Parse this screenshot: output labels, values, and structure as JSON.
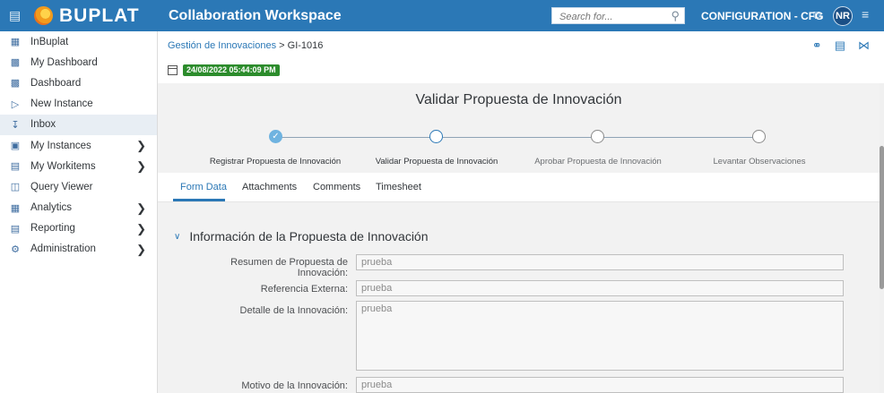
{
  "topbar": {
    "brand": "BUPLAT",
    "title": "Collaboration Workspace",
    "search_placeholder": "Search for...",
    "config_label": "CONFIGURATION - CFG",
    "avatar_initials": "NR",
    "accent_color": "#2b78b6"
  },
  "sidebar": {
    "items": [
      {
        "label": "InBuplat",
        "icon": "building-icon"
      },
      {
        "label": "My Dashboard",
        "icon": "dashboard-icon"
      },
      {
        "label": "Dashboard",
        "icon": "dashboard-icon"
      },
      {
        "label": "New Instance",
        "icon": "play-plus-icon"
      },
      {
        "label": "Inbox",
        "icon": "inbox-download-icon",
        "active": true
      },
      {
        "label": "My Instances",
        "icon": "instances-icon",
        "has_chevron": true
      },
      {
        "label": "My Workitems",
        "icon": "workitems-icon",
        "has_chevron": true
      },
      {
        "label": "Query Viewer",
        "icon": "query-icon"
      },
      {
        "label": "Analytics",
        "icon": "analytics-icon",
        "has_chevron": true
      },
      {
        "label": "Reporting",
        "icon": "reporting-icon",
        "has_chevron": true
      },
      {
        "label": "Administration",
        "icon": "admin-gear-icon",
        "has_chevron": true
      }
    ]
  },
  "header": {
    "breadcrumb_link": "Gestión de Innovaciones",
    "breadcrumb_separator": ">",
    "breadcrumb_current": "GI-1016",
    "timestamp": "24/08/2022 05:44:09 PM",
    "timestamp_color": "#2c8c2c"
  },
  "page": {
    "title": "Validar Propuesta de Innovación"
  },
  "steps": [
    {
      "label": "Registrar Propuesta de Innovación",
      "state": "done"
    },
    {
      "label": "Validar Propuesta de Innovación",
      "state": "current"
    },
    {
      "label": "Aprobar Propuesta de Innovación",
      "state": "pending"
    },
    {
      "label": "Levantar Observaciones",
      "state": "pending"
    }
  ],
  "tabs": [
    {
      "label": "Form Data",
      "active": true
    },
    {
      "label": "Attachments"
    },
    {
      "label": "Comments"
    },
    {
      "label": "Timesheet"
    }
  ],
  "section": {
    "title": "Información de la Propuesta de Innovación"
  },
  "fields": {
    "resumen": {
      "label_line1": "Resumen de Propuesta de",
      "label_line2": "Innovación:",
      "value": "prueba"
    },
    "referencia": {
      "label": "Referencia Externa:",
      "value": "prueba"
    },
    "detalle": {
      "label": "Detalle de la Innovación:",
      "value": "prueba"
    },
    "motivo": {
      "label": "Motivo de la Innovación:",
      "value": "prueba"
    }
  }
}
